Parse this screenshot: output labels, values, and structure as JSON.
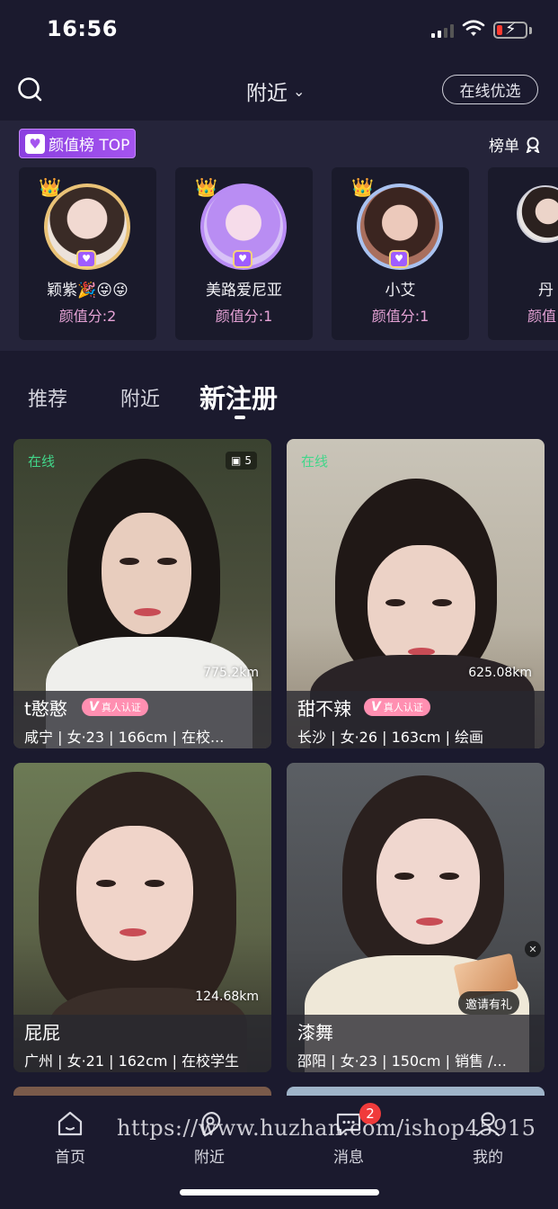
{
  "status_bar": {
    "time": "16:56"
  },
  "header": {
    "title": "附近",
    "online_button": "在线优选"
  },
  "ranking": {
    "badge": "颜值榜 TOP",
    "link": "榜单",
    "items": [
      {
        "name": "颖紫🎉😜😜",
        "score": "颜值分:2",
        "frame_color": "#e9c277"
      },
      {
        "name": "美路爱尼亚",
        "score": "颜值分:1",
        "frame_color": "#b98cf5"
      },
      {
        "name": "小艾",
        "score": "颜值分:1",
        "frame_color": "#a9c2f0"
      },
      {
        "name": "丹",
        "score": "颜值",
        "frame_color": "#cfcfd8"
      }
    ]
  },
  "tabs": [
    {
      "label": "推荐"
    },
    {
      "label": "附近"
    },
    {
      "label": "新注册",
      "active": true
    }
  ],
  "cards": [
    {
      "name": "t憨憨",
      "online": "在线",
      "photo_count": "5",
      "distance": "775.2km",
      "verified": "真人认证",
      "meta": "咸宁 | 女·23 | 166cm | 在校..."
    },
    {
      "name": "甜不辣",
      "online": "在线",
      "distance": "625.08km",
      "verified": "真人认证",
      "meta": "长沙 | 女·26 | 163cm | 绘画"
    },
    {
      "name": "屁屁",
      "distance": "124.68km",
      "meta": "广州 | 女·21 | 162cm | 在校学生"
    },
    {
      "name": "漆舞",
      "meta": "邵阳 | 女·23 | 150cm | 销售 /..."
    }
  ],
  "invite": {
    "label": "邀请有礼"
  },
  "tabbar": [
    {
      "label": "首页",
      "icon": "home-icon"
    },
    {
      "label": "附近",
      "icon": "nearby-icon"
    },
    {
      "label": "消息",
      "icon": "message-icon",
      "badge": "2"
    },
    {
      "label": "我的",
      "icon": "profile-icon"
    }
  ],
  "watermark": "https://www.huzhan.com/ishop45915"
}
